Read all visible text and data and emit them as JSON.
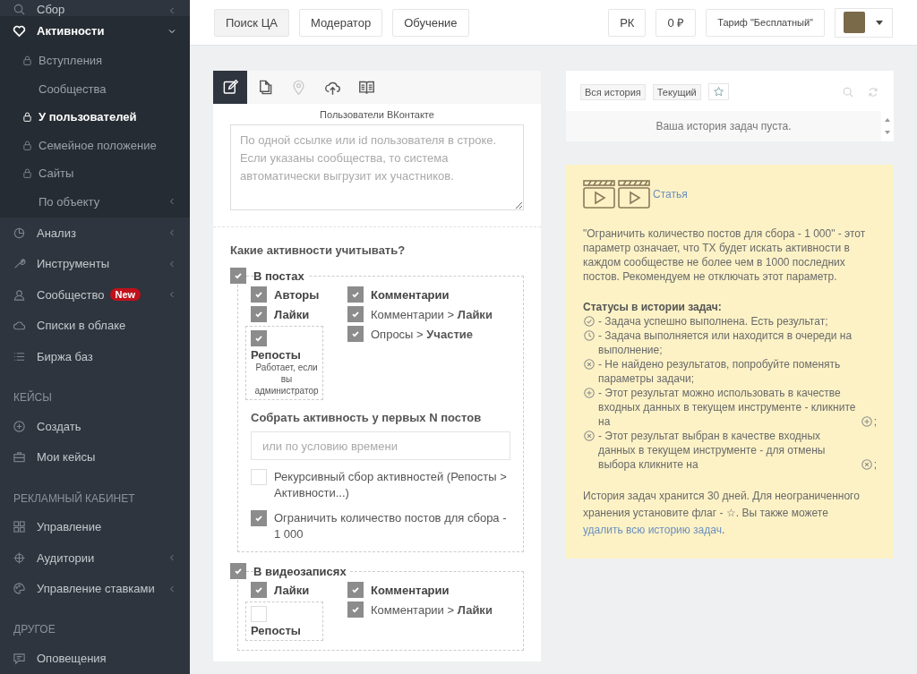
{
  "sidebar": {
    "items": [
      {
        "kind": "item",
        "label": "Сбор",
        "arrow": true,
        "expanded": false
      },
      {
        "kind": "item",
        "label": "Активности",
        "arrow": true,
        "expanded": true,
        "children": [
          {
            "label": "Вступления",
            "locked": true,
            "selected": false
          },
          {
            "label": "Сообщества",
            "locked": false,
            "selected": false
          },
          {
            "label": "У пользователей",
            "locked": true,
            "selected": true
          },
          {
            "label": "Семейное положение",
            "locked": true,
            "selected": false
          },
          {
            "label": "Сайты",
            "locked": true,
            "selected": false
          },
          {
            "label": "По объекту",
            "locked": false,
            "selected": false,
            "arrow": true
          }
        ]
      },
      {
        "kind": "item",
        "label": "Анализ",
        "arrow": true,
        "expanded": false
      },
      {
        "kind": "item",
        "label": "Инструменты",
        "arrow": true,
        "expanded": false
      },
      {
        "kind": "item",
        "label": "Сообщество",
        "badge": "New",
        "arrow": true,
        "expanded": false
      },
      {
        "kind": "item",
        "label": "Списки в облаке",
        "arrow": false,
        "expanded": false
      },
      {
        "kind": "item",
        "label": "Биржа баз",
        "arrow": false,
        "expanded": false
      },
      {
        "kind": "section",
        "label": "КЕЙСЫ"
      },
      {
        "kind": "item",
        "label": "Создать",
        "arrow": false,
        "expanded": false
      },
      {
        "kind": "item",
        "label": "Мои кейсы",
        "arrow": false,
        "expanded": false
      },
      {
        "kind": "section",
        "label": "РЕКЛАМНЫЙ КАБИНЕТ"
      },
      {
        "kind": "item",
        "label": "Управление",
        "arrow": false,
        "expanded": false
      },
      {
        "kind": "item",
        "label": "Аудитории",
        "arrow": true,
        "expanded": false
      },
      {
        "kind": "item",
        "label": "Управление ставками",
        "arrow": true,
        "expanded": false
      },
      {
        "kind": "section",
        "label": "ДРУГОЕ"
      },
      {
        "kind": "item",
        "label": "Оповещения",
        "arrow": false,
        "expanded": false
      }
    ]
  },
  "topbar": {
    "left_buttons": [
      {
        "label": "Поиск ЦА",
        "selected": true
      },
      {
        "label": "Модератор",
        "selected": false
      },
      {
        "label": "Обучение",
        "selected": false
      }
    ],
    "right_buttons": [
      "РК",
      "0 ₽",
      "Тариф \"Бесплатный\""
    ]
  },
  "tool": {
    "tabs": [
      {
        "kind": "edit",
        "selected": true
      },
      {
        "kind": "copy",
        "selected": false
      },
      {
        "kind": "pin",
        "selected": false
      },
      {
        "kind": "upload",
        "selected": false
      },
      {
        "kind": "book",
        "selected": false
      }
    ],
    "input_label": "Пользователи ВКонтакте",
    "input": {
      "placeholder": "По одной ссылке или id пользователя в строке. Если указаны сообщества, то система автоматически выгрузит их участников."
    },
    "question": "Какие активности учитывать?",
    "groups": [
      {
        "label": "В постах",
        "checked": true,
        "left": [
          {
            "kind": "plain",
            "label": "Авторы",
            "bold": true,
            "checked": true
          },
          {
            "kind": "plain",
            "label": "Лайки",
            "bold": true,
            "checked": true
          },
          {
            "kind": "boxed",
            "label": "Репосты",
            "bold": true,
            "checked": true,
            "note": "Работает, если вы администратор"
          }
        ],
        "right": [
          {
            "kind": "plain",
            "label": "Комментарии",
            "bold": true,
            "checked": true
          },
          {
            "kind": "plain",
            "label": "Комментарии > **Лайки**",
            "bold": false,
            "checked": true
          },
          {
            "kind": "plain",
            "label": "Опросы > **Участие**",
            "bold": false,
            "checked": true
          }
        ],
        "limit_label": "Собрать активность у первых N постов",
        "limit_input": {
          "placeholder": "или по условию времени"
        },
        "options": [
          {
            "label": "Рекурсивный сбор активностей (Репосты > Активности...)",
            "checked": false
          },
          {
            "label": "Ограничить количество постов для сбора - 1 000",
            "checked": true
          }
        ]
      },
      {
        "label": "В видеозаписях",
        "checked": true,
        "left": [
          {
            "kind": "plain",
            "label": "Лайки",
            "bold": true,
            "checked": true
          },
          {
            "kind": "boxed",
            "label": "Репосты",
            "bold": true,
            "checked": false
          }
        ],
        "right": [
          {
            "kind": "plain",
            "label": "Комментарии",
            "bold": true,
            "checked": true
          },
          {
            "kind": "plain",
            "label": "Комментарии > **Лайки**",
            "bold": false,
            "checked": true
          }
        ]
      }
    ]
  },
  "history": {
    "tabs": [
      "Вся история",
      "Текущий"
    ],
    "empty": "Ваша история задач пуста."
  },
  "info": {
    "link": "Статья",
    "paragraph": "\"Ограничить количество постов для сбора - 1 000\" - этот параметр означает, что ТХ будет искать активности в каждом сообществе не более чем в 1000 последних постов. Рекомендуем не отключать этот параметр.",
    "statuses_title": "Статусы в истории задач:",
    "statuses": [
      {
        "kind": "done",
        "text": "- Задача успешно выполнена. Есть результат;"
      },
      {
        "kind": "pending",
        "text": "- Задача выполняется или находится в очереди на выполнение;"
      },
      {
        "kind": "empty",
        "text": "- Не найдено результатов, попробуйте поменять параметры задачи;"
      },
      {
        "kind": "add",
        "text": "- Этот результат можно использовать в качестве входных данных в текущем инструменте - кликните на",
        "tail": ";"
      },
      {
        "kind": "remove",
        "text": "- Этот результат выбран в качестве входных данных в текущем инструменте - для отмены выбора кликните на",
        "tail": ";"
      }
    ],
    "footer_text": "История задач хранится 30 дней. Для неограниченного хранения установите флаг - ☆. Вы также можете",
    "footer_link": "удалить всю историю задач",
    "footer_end": "."
  }
}
